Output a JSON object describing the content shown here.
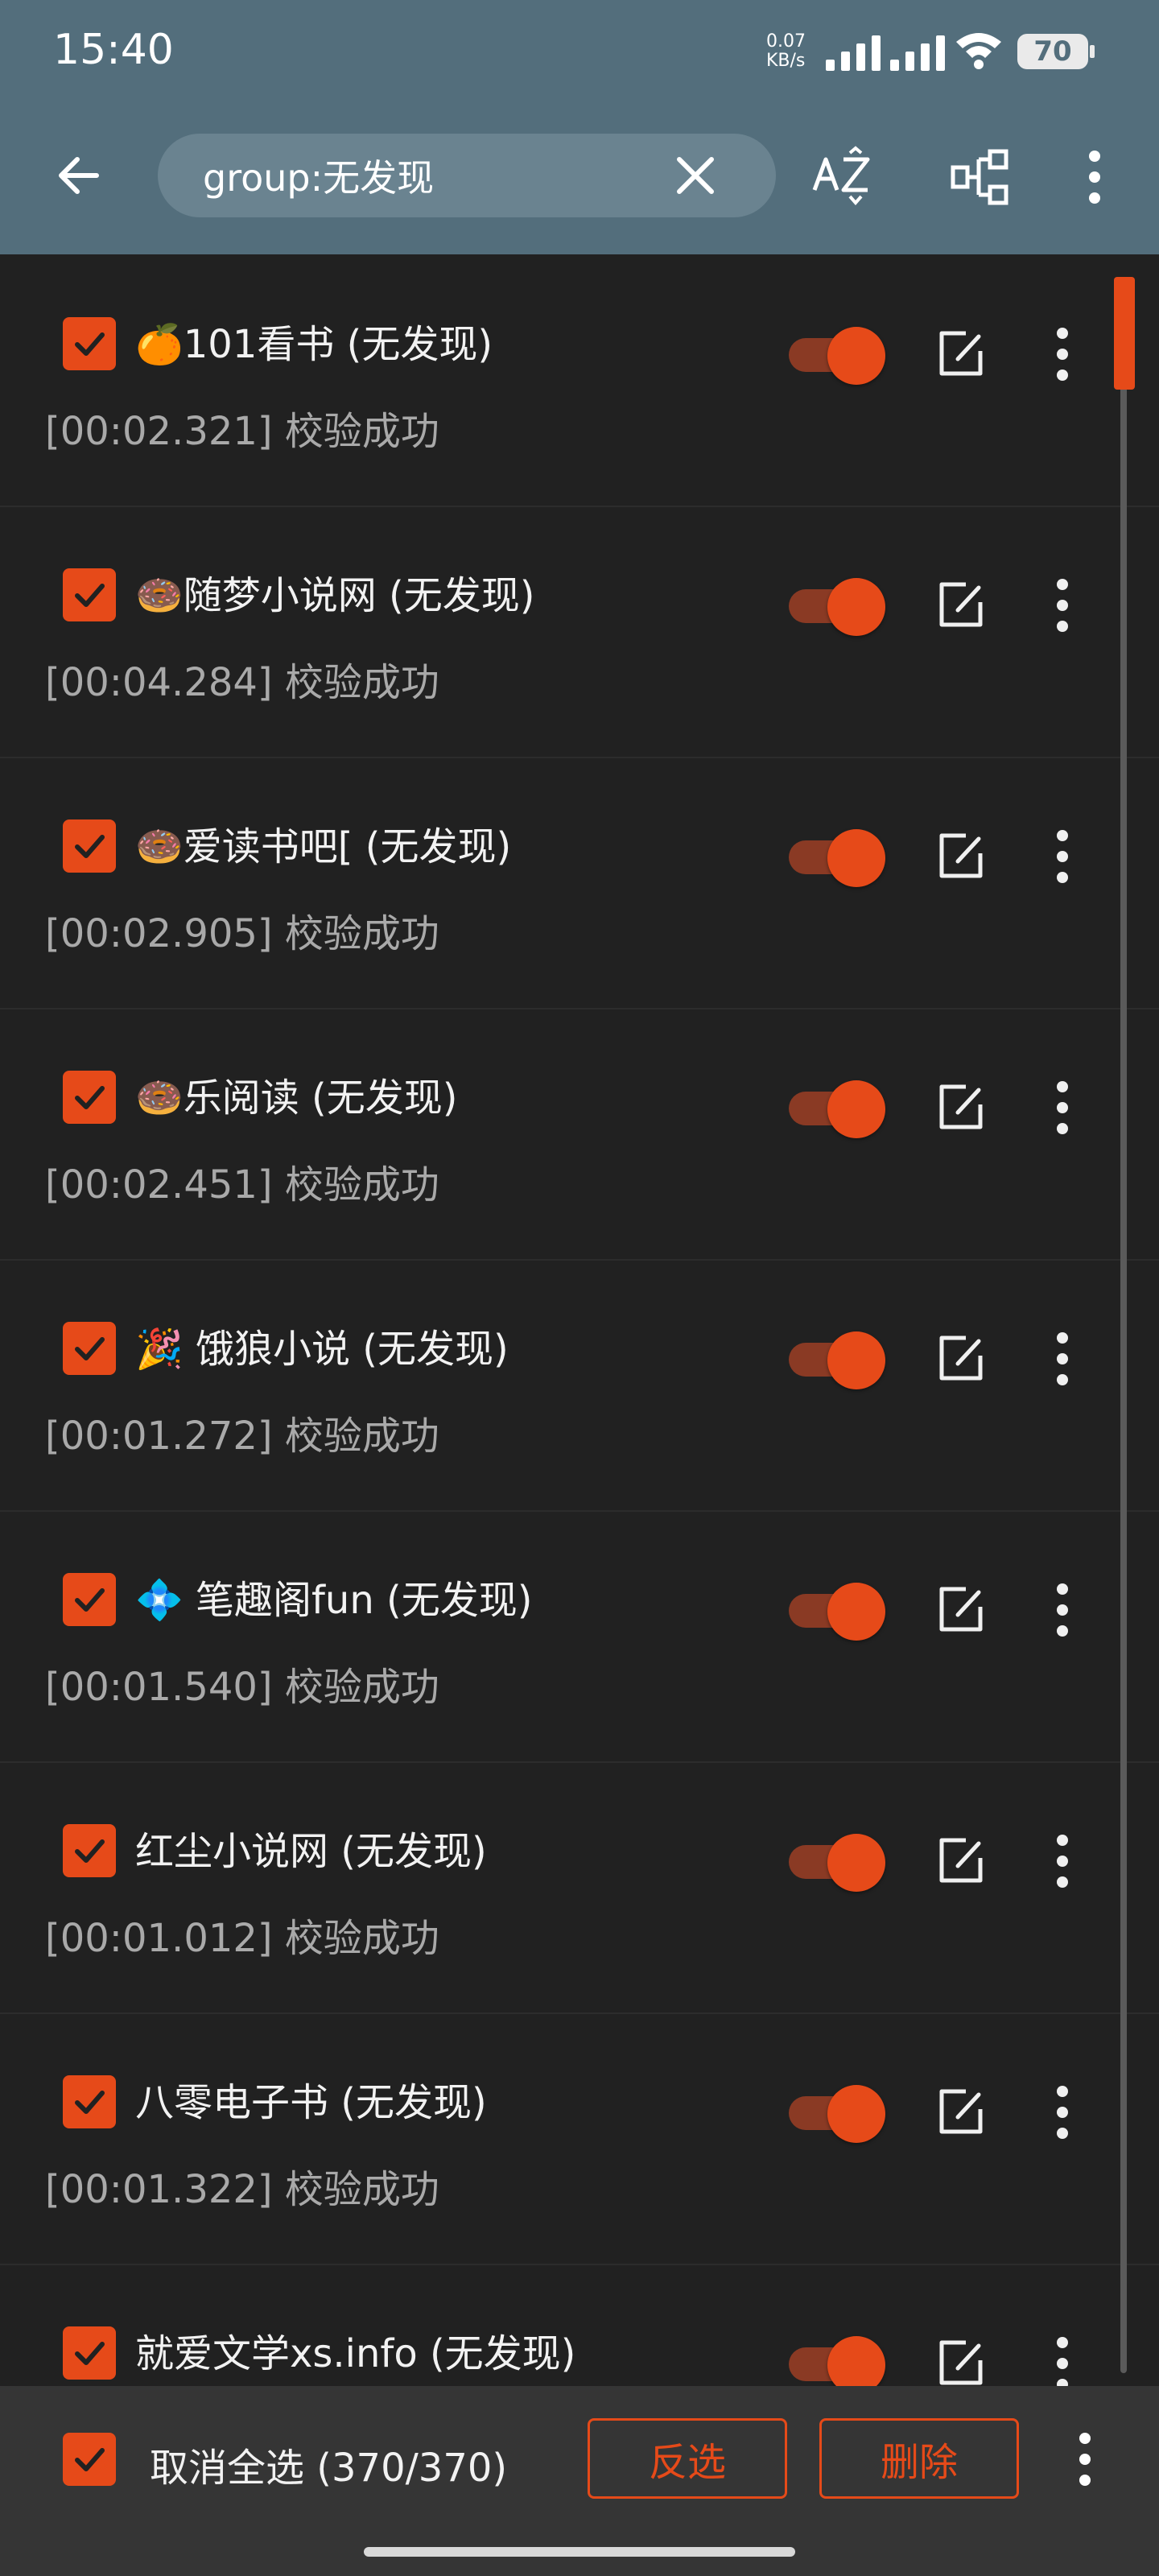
{
  "status_bar": {
    "time": "15:40",
    "net_speed_value": "0.07",
    "net_speed_unit": "KB/s",
    "battery": "70"
  },
  "toolbar": {
    "search_value": "group:无发现"
  },
  "items": [
    {
      "emoji": "🍊",
      "title": "101看书 (无发现)",
      "status": "[00:02.321] 校验成功"
    },
    {
      "emoji": "🍩",
      "title": "随梦小说网 (无发现)",
      "status": "[00:04.284] 校验成功"
    },
    {
      "emoji": "🍩",
      "title": "爱读书吧[ (无发现)",
      "status": "[00:02.905] 校验成功"
    },
    {
      "emoji": "🍩",
      "title": "乐阅读 (无发现)",
      "status": "[00:02.451] 校验成功"
    },
    {
      "emoji": "🎉",
      "title": " 饿狼小说 (无发现)",
      "status": "[00:01.272] 校验成功"
    },
    {
      "emoji": "💠",
      "title": " 笔趣阁fun (无发现)",
      "status": "[00:01.540] 校验成功"
    },
    {
      "emoji": "",
      "title": "红尘小说网 (无发现)",
      "status": "[00:01.012] 校验成功"
    },
    {
      "emoji": "",
      "title": "八零电子书 (无发现)",
      "status": "[00:01.322] 校验成功"
    },
    {
      "emoji": "",
      "title": "就爱文学xs.info (无发现)",
      "status": ""
    }
  ],
  "bottom_bar": {
    "select_label": "取消全选 (370/370)",
    "invert_label": "反选",
    "delete_label": "删除"
  },
  "colors": {
    "accent": "#e64a19",
    "header": "#536e7c",
    "background": "#212121"
  }
}
